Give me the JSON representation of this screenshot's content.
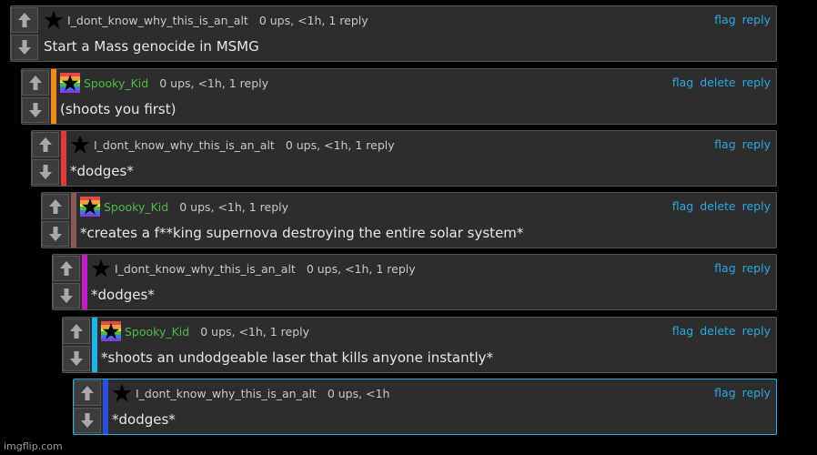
{
  "colors": {
    "link": "#2aa8e0",
    "username_green": "#4fb84a",
    "selected_border": "#2aa8e0"
  },
  "comments": [
    {
      "username": "I_dont_know_why_this_is_an_alt",
      "avatar_icon": "black-star-icon",
      "meta": "0 ups, <1h, 1 reply",
      "text": "Start a Mass genocide in MSMG",
      "actions": [
        "flag",
        "reply"
      ],
      "bar_color": "",
      "green_name": false
    },
    {
      "username": "Spooky_Kid",
      "avatar_icon": "rainbow-star-icon",
      "meta": "0 ups, <1h, 1 reply",
      "text": "(shoots you first)",
      "actions": [
        "flag",
        "delete",
        "reply"
      ],
      "bar_color": "#f08a1c",
      "green_name": true
    },
    {
      "username": "I_dont_know_why_this_is_an_alt",
      "avatar_icon": "black-star-icon",
      "meta": "0 ups, <1h, 1 reply",
      "text": "*dodges*",
      "actions": [
        "flag",
        "reply"
      ],
      "bar_color": "#e03a3a",
      "green_name": false
    },
    {
      "username": "Spooky_Kid",
      "avatar_icon": "rainbow-star-icon",
      "meta": "0 ups, <1h, 1 reply",
      "text": "*creates a f**king supernova destroying the entire solar system*",
      "actions": [
        "flag",
        "delete",
        "reply"
      ],
      "bar_color": "#8a5a52",
      "green_name": true
    },
    {
      "username": "I_dont_know_why_this_is_an_alt",
      "avatar_icon": "black-star-icon",
      "meta": "0 ups, <1h, 1 reply",
      "text": "*dodges*",
      "actions": [
        "flag",
        "reply"
      ],
      "bar_color": "#c21ec6",
      "green_name": false
    },
    {
      "username": "Spooky_Kid",
      "avatar_icon": "rainbow-star-icon",
      "meta": "0 ups, <1h, 1 reply",
      "text": "*shoots an undodgeable laser that kills anyone instantly*",
      "actions": [
        "flag",
        "delete",
        "reply"
      ],
      "bar_color": "#1fb4e6",
      "green_name": true
    },
    {
      "username": "I_dont_know_why_this_is_an_alt",
      "avatar_icon": "black-star-icon",
      "meta": "0 ups, <1h",
      "text": "*dodges*",
      "actions": [
        "flag",
        "reply"
      ],
      "bar_color": "#2a4ee0",
      "green_name": false
    }
  ],
  "watermark": "imgflip.com"
}
